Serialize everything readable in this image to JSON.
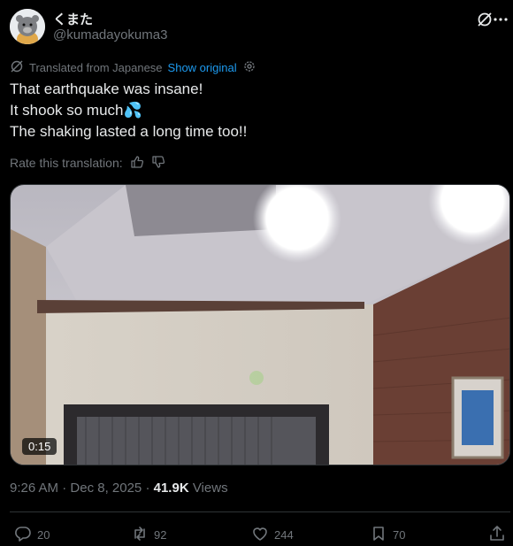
{
  "author": {
    "display_name": "くまた",
    "handle": "@kumadayokuma3"
  },
  "translation": {
    "notice": "Translated from Japanese",
    "show_original": "Show original"
  },
  "tweet_lines": [
    "That earthquake was insane!",
    "It shook so much💦",
    "The shaking lasted a long time too!!"
  ],
  "rate": {
    "label": "Rate this translation:"
  },
  "video": {
    "duration": "0:15"
  },
  "meta": {
    "time": "9:26 AM",
    "separator": "·",
    "date": "Dec 8, 2025",
    "views_count": "41.9K",
    "views_label": "Views"
  },
  "actions": {
    "replies": "20",
    "reposts": "92",
    "likes": "244",
    "bookmarks": "70"
  },
  "icons": {
    "grok": "grok-icon",
    "more": "more-icon",
    "translate": "translate-icon",
    "settings": "gear-icon",
    "thumbs_up": "thumbs-up-icon",
    "thumbs_down": "thumbs-down-icon",
    "reply": "reply-icon",
    "repost": "repost-icon",
    "like": "heart-icon",
    "bookmark": "bookmark-icon",
    "share": "share-icon"
  },
  "colors": {
    "background": "#000000",
    "text": "#e7e9ea",
    "secondary": "#71767b",
    "accent": "#1d9bf0",
    "border": "#2f3336"
  }
}
